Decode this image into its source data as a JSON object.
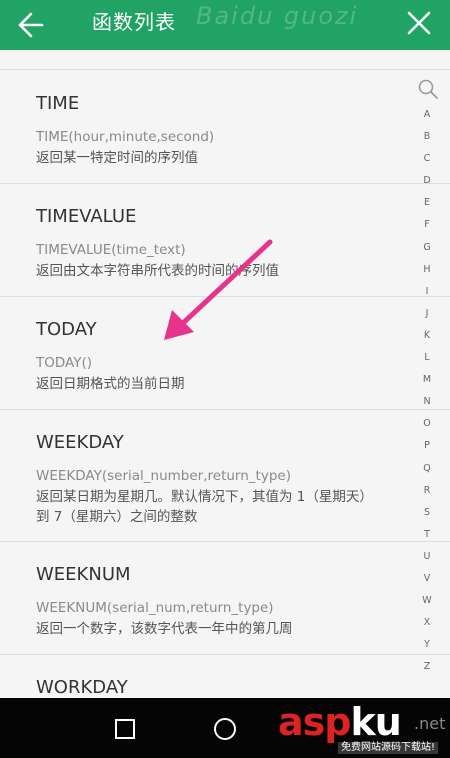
{
  "header": {
    "title": "函数列表",
    "watermark": "Baidu guozi",
    "back_icon": "arrow-left-icon",
    "close_icon": "close-icon"
  },
  "functions": [
    {
      "name": "TIME",
      "signature": "TIME(hour,minute,second)",
      "description": "返回某一特定时间的序列值"
    },
    {
      "name": "TIMEVALUE",
      "signature": "TIMEVALUE(time_text)",
      "description": "返回由文本字符串所代表的时间的序列值"
    },
    {
      "name": "TODAY",
      "signature": "TODAY()",
      "description": "返回日期格式的当前日期"
    },
    {
      "name": "WEEKDAY",
      "signature": "WEEKDAY(serial_number,return_type)",
      "description": "返回某日期为星期几。默认情况下，其值为 1（星期天）到 7（星期六）之间的整数"
    },
    {
      "name": "WEEKNUM",
      "signature": "WEEKNUM(serial_num,return_type)",
      "description": "返回一个数字，该数字代表一年中的第几周"
    },
    {
      "name": "WORKDAY",
      "signature": "",
      "description": ""
    }
  ],
  "index_bar": {
    "search_icon": "search-icon",
    "letters": [
      "A",
      "B",
      "C",
      "D",
      "E",
      "F",
      "G",
      "H",
      "I",
      "J",
      "K",
      "L",
      "M",
      "N",
      "O",
      "P",
      "Q",
      "R",
      "S",
      "T",
      "U",
      "V",
      "W",
      "X",
      "Y",
      "Z"
    ]
  },
  "annotation": {
    "arrow_color": "#e8338a"
  },
  "nav_bar": {
    "square_icon": "recent-apps-icon",
    "circle_icon": "home-icon",
    "back_icon": "triangle-back-icon"
  },
  "watermark_logo": {
    "brand_main": "asp",
    "brand_accent": "ku",
    "tld": ".net",
    "tagline": "免费网站源码下载站!"
  },
  "colors": {
    "header_bg": "#21a366",
    "background": "#f5f5f5",
    "nav_bg": "#050505"
  }
}
